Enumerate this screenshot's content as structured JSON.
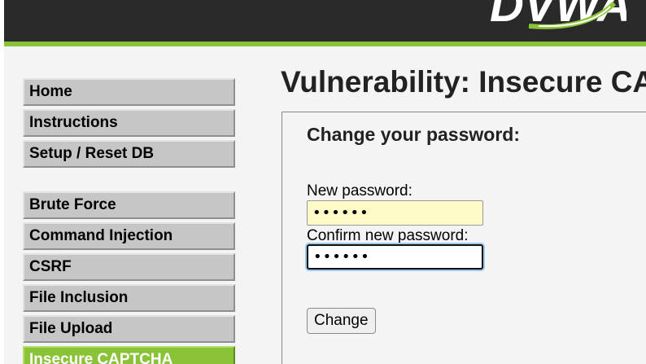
{
  "header": {
    "logo_text": "DVWA"
  },
  "sidebar": {
    "items": [
      {
        "label": "Home"
      },
      {
        "label": "Instructions"
      },
      {
        "label": "Setup / Reset DB"
      },
      {
        "label": "Brute Force"
      },
      {
        "label": "Command Injection"
      },
      {
        "label": "CSRF"
      },
      {
        "label": "File Inclusion"
      },
      {
        "label": "File Upload"
      },
      {
        "label": "Insecure CAPTCHA",
        "selected": true
      }
    ]
  },
  "main": {
    "title": "Vulnerability: Insecure CAPTCHA",
    "form": {
      "heading": "Change your password:",
      "new_password_label": "New password:",
      "new_password_value": "••••••",
      "confirm_password_label": "Confirm new password:",
      "confirm_password_value": "••••••",
      "submit_label": "Change"
    }
  },
  "colors": {
    "accent": "#8ac238",
    "header_bg": "#2a2a2a",
    "menu_bg": "#c6c6c6"
  }
}
